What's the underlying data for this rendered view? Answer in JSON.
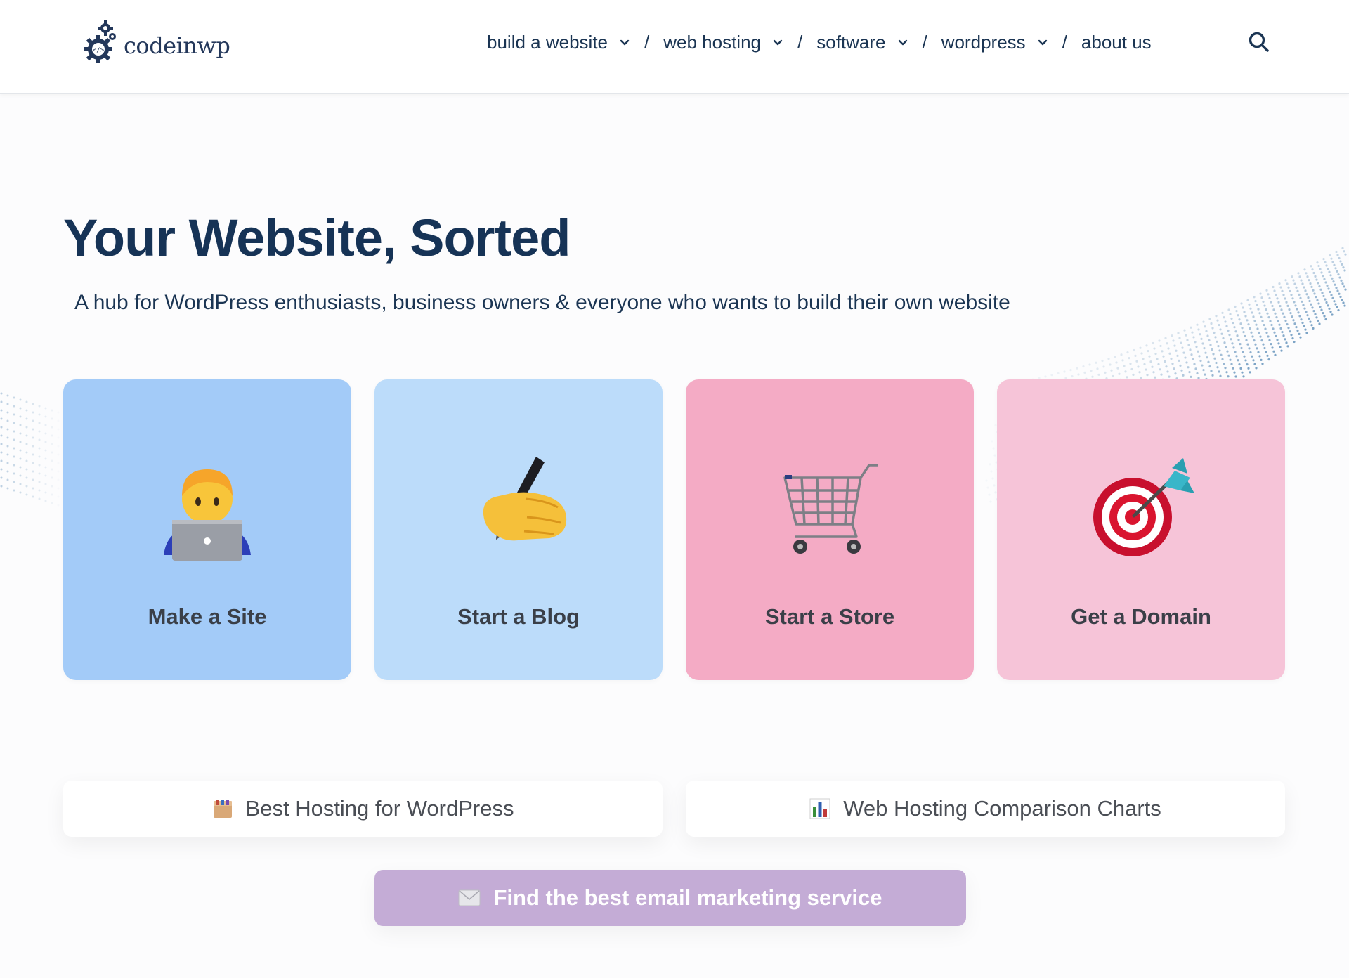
{
  "brand": {
    "name": "codeinwp",
    "gear_icon": "gear-code-icon"
  },
  "nav": {
    "items": [
      {
        "label": "build a website",
        "icon": "chevron-down-icon"
      },
      {
        "label": "web hosting",
        "icon": "chevron-down-icon"
      },
      {
        "label": "software",
        "icon": "chevron-down-icon"
      },
      {
        "label": "wordpress",
        "icon": "chevron-down-icon"
      },
      {
        "label": "about us"
      }
    ],
    "separator": "/",
    "search_icon": "search-icon"
  },
  "hero": {
    "title": "Your Website, Sorted",
    "subtitle": "A hub for WordPress enthusiasts, business owners & everyone who wants to build their own website"
  },
  "cards": [
    {
      "label": "Make a Site",
      "icon": "technologist-laptop-icon",
      "color": "#a3cbf8"
    },
    {
      "label": "Start a Blog",
      "icon": "writing-hand-icon",
      "color": "#bcdcfa"
    },
    {
      "label": "Start a Store",
      "icon": "shopping-cart-icon",
      "color": "#f4abc5"
    },
    {
      "label": "Get a Domain",
      "icon": "bullseye-dart-icon",
      "color": "#f6c4d8"
    }
  ],
  "links": [
    {
      "label": "Best Hosting for WordPress",
      "icon": "package-box-icon"
    },
    {
      "label": "Web Hosting Comparison Charts",
      "icon": "bar-chart-icon"
    },
    {
      "label": "Find the best email marketing service",
      "icon": "envelope-icon",
      "color": "#c4acd6"
    }
  ],
  "colors": {
    "heading": "#163356",
    "text": "#1b3553",
    "wave_dots": "#6f9ac0"
  }
}
